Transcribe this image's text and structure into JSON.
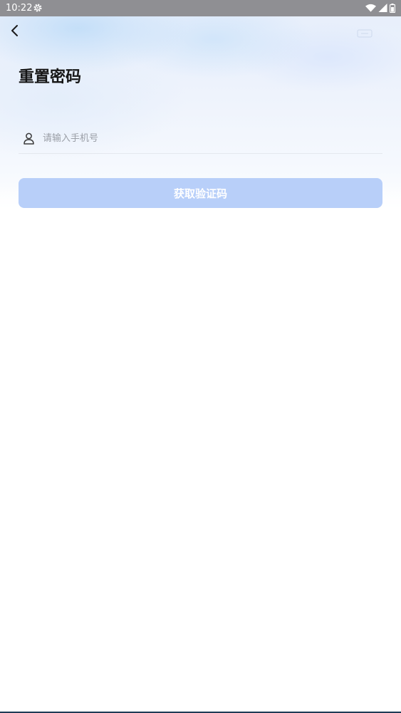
{
  "status_bar": {
    "time": "10:22",
    "icons": [
      "settings-gear-icon",
      "wifi-icon",
      "cell-signal-icon",
      "battery-icon"
    ]
  },
  "header": {
    "back_icon": "chevron-left-icon",
    "title": "重置密码"
  },
  "form": {
    "phone": {
      "icon": "user-icon",
      "value": "",
      "placeholder": "请输入手机号"
    },
    "submit_label": "获取验证码"
  },
  "colors": {
    "button_disabled": "#b8cff9",
    "title_text": "#151515",
    "placeholder_text": "#9a9ea6",
    "status_bar_bg": "#8f8f93"
  }
}
